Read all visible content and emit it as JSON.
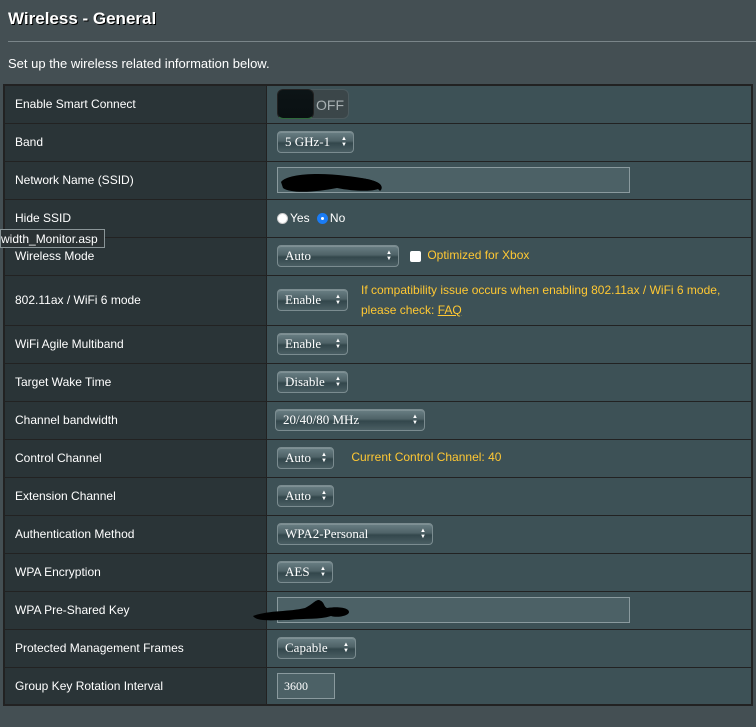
{
  "page": {
    "title": "Wireless - General",
    "subtitle": "Set up the wireless related information below."
  },
  "tooltip": "width_Monitor.asp",
  "rows": {
    "smart_connect": {
      "label": "Enable Smart Connect",
      "toggle_state": "OFF"
    },
    "band": {
      "label": "Band",
      "value": "5 GHz-1"
    },
    "ssid": {
      "label": "Network Name (SSID)",
      "value": ""
    },
    "hide_ssid": {
      "label": "Hide SSID",
      "yes": "Yes",
      "no": "No",
      "selected": "No"
    },
    "wireless_mode": {
      "label": "Wireless Mode",
      "value": "Auto",
      "xbox_label": "Optimized for Xbox",
      "xbox_checked": false
    },
    "wifi6": {
      "label": "802.11ax / WiFi 6 mode",
      "value": "Enable",
      "note_line1": "If compatibility issue occurs when enabling 802.11ax / WiFi 6 mode,",
      "note_line2": "please check: ",
      "faq_link": "FAQ"
    },
    "agile": {
      "label": "WiFi Agile Multiband",
      "value": "Enable"
    },
    "twt": {
      "label": "Target Wake Time",
      "value": "Disable"
    },
    "bandwidth": {
      "label": "Channel bandwidth",
      "value": "20/40/80 MHz"
    },
    "control_channel": {
      "label": "Control Channel",
      "value": "Auto",
      "note": "Current Control Channel: 40"
    },
    "extension_channel": {
      "label": "Extension Channel",
      "value": "Auto"
    },
    "auth": {
      "label": "Authentication Method",
      "value": "WPA2-Personal"
    },
    "encryption": {
      "label": "WPA Encryption",
      "value": "AES"
    },
    "psk": {
      "label": "WPA Pre-Shared Key",
      "value": ""
    },
    "pmf": {
      "label": "Protected Management Frames",
      "value": "Capable"
    },
    "gk_interval": {
      "label": "Group Key Rotation Interval",
      "value": "3600"
    }
  },
  "colors": {
    "page_bg": "#444f53",
    "label_bg": "#2a3437",
    "value_bg": "#3d5156",
    "note": "#ffc833",
    "radio_selected": "#1a7cf5"
  }
}
